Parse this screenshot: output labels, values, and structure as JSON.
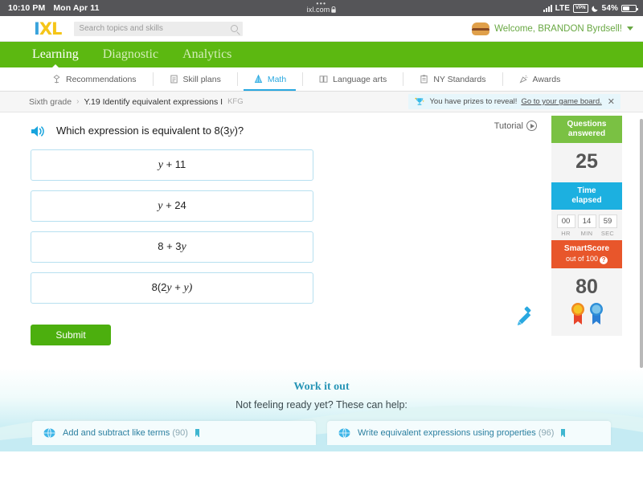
{
  "statusbar": {
    "time": "10:10 PM",
    "date": "Mon Apr 11",
    "dots": "•••",
    "url": "ixl.com",
    "lock_icon": "lock-icon",
    "network": "LTE",
    "vpn": "VPN",
    "moon_icon": "moon-icon",
    "battery": "54%"
  },
  "header": {
    "logo_i": "I",
    "logo_xl": "XL",
    "search_placeholder": "Search topics and skills",
    "search_icon": "search-icon",
    "avatar_icon": "hamburger-avatar-icon",
    "welcome": "Welcome, BRANDON Byrdsell!",
    "caret_icon": "chevron-down-icon"
  },
  "mainnav": {
    "items": [
      {
        "label": "Learning",
        "active": true
      },
      {
        "label": "Diagnostic",
        "active": false
      },
      {
        "label": "Analytics",
        "active": false
      }
    ]
  },
  "subtabs": {
    "items": [
      {
        "label": "Recommendations",
        "icon": "recommendations-icon",
        "active": false
      },
      {
        "label": "Skill plans",
        "icon": "skill-plans-icon",
        "active": false
      },
      {
        "label": "Math",
        "icon": "math-compass-icon",
        "active": true
      },
      {
        "label": "Language arts",
        "icon": "book-icon",
        "active": false
      },
      {
        "label": "NY Standards",
        "icon": "clipboard-icon",
        "active": false
      },
      {
        "label": "Awards",
        "icon": "confetti-icon",
        "active": false
      }
    ]
  },
  "breadcrumb": {
    "grade": "Sixth grade",
    "separator": "›",
    "skill": "Y.19 Identify equivalent expressions I",
    "code": "KFG"
  },
  "prize_banner": {
    "trophy_icon": "trophy-icon",
    "text": "You have prizes to reveal!",
    "link": "Go to your game board.",
    "close_icon": "close-icon"
  },
  "question": {
    "speaker_icon": "speaker-icon",
    "prefix": "Which expression is equivalent to 8(3",
    "var": "y",
    "suffix": ")?"
  },
  "options": [
    {
      "pre": "",
      "v1": "y",
      "mid": " + 11",
      "post": ""
    },
    {
      "pre": "",
      "v1": "y",
      "mid": " + 24",
      "post": ""
    },
    {
      "pre": "8 + 3",
      "v1": "y",
      "mid": "",
      "post": ""
    },
    {
      "pre": "8(2",
      "v1": "y",
      "mid": " + ",
      "post": "y)"
    }
  ],
  "submit_label": "Submit",
  "tutorial": {
    "label": "Tutorial",
    "play_icon": "play-circle-icon"
  },
  "scorepanel": {
    "questions_label_l1": "Questions",
    "questions_label_l2": "answered",
    "questions_value": "25",
    "time_label_l1": "Time",
    "time_label_l2": "elapsed",
    "timer": [
      {
        "value": "00",
        "label": "HR"
      },
      {
        "value": "14",
        "label": "MIN"
      },
      {
        "value": "59",
        "label": "SEC"
      }
    ],
    "smartscore_label": "SmartScore",
    "smartscore_sub": "out of 100",
    "smartscore_help_icon": "question-mark-icon",
    "smartscore_value": "80",
    "ribbon_icons": [
      "gold-ribbon-icon",
      "blue-ribbon-icon"
    ]
  },
  "scratchpad_icon": "pencil-icon",
  "workitout": {
    "title": "Work it out",
    "subtitle": "Not feeling ready yet? These can help:",
    "cards": [
      {
        "gem_icon": "gem-icon",
        "title": "Add and subtract like terms",
        "count": "(90)",
        "bookmark_icon": "bookmark-icon"
      },
      {
        "gem_icon": "gem-icon",
        "title": "Write equivalent expressions using properties",
        "count": "(96)",
        "bookmark_icon": "bookmark-icon"
      }
    ]
  },
  "colors": {
    "green_nav": "#5cb811",
    "blue_accent": "#29a8e0",
    "orange": "#e8562b",
    "submit_green": "#4caf0e"
  }
}
